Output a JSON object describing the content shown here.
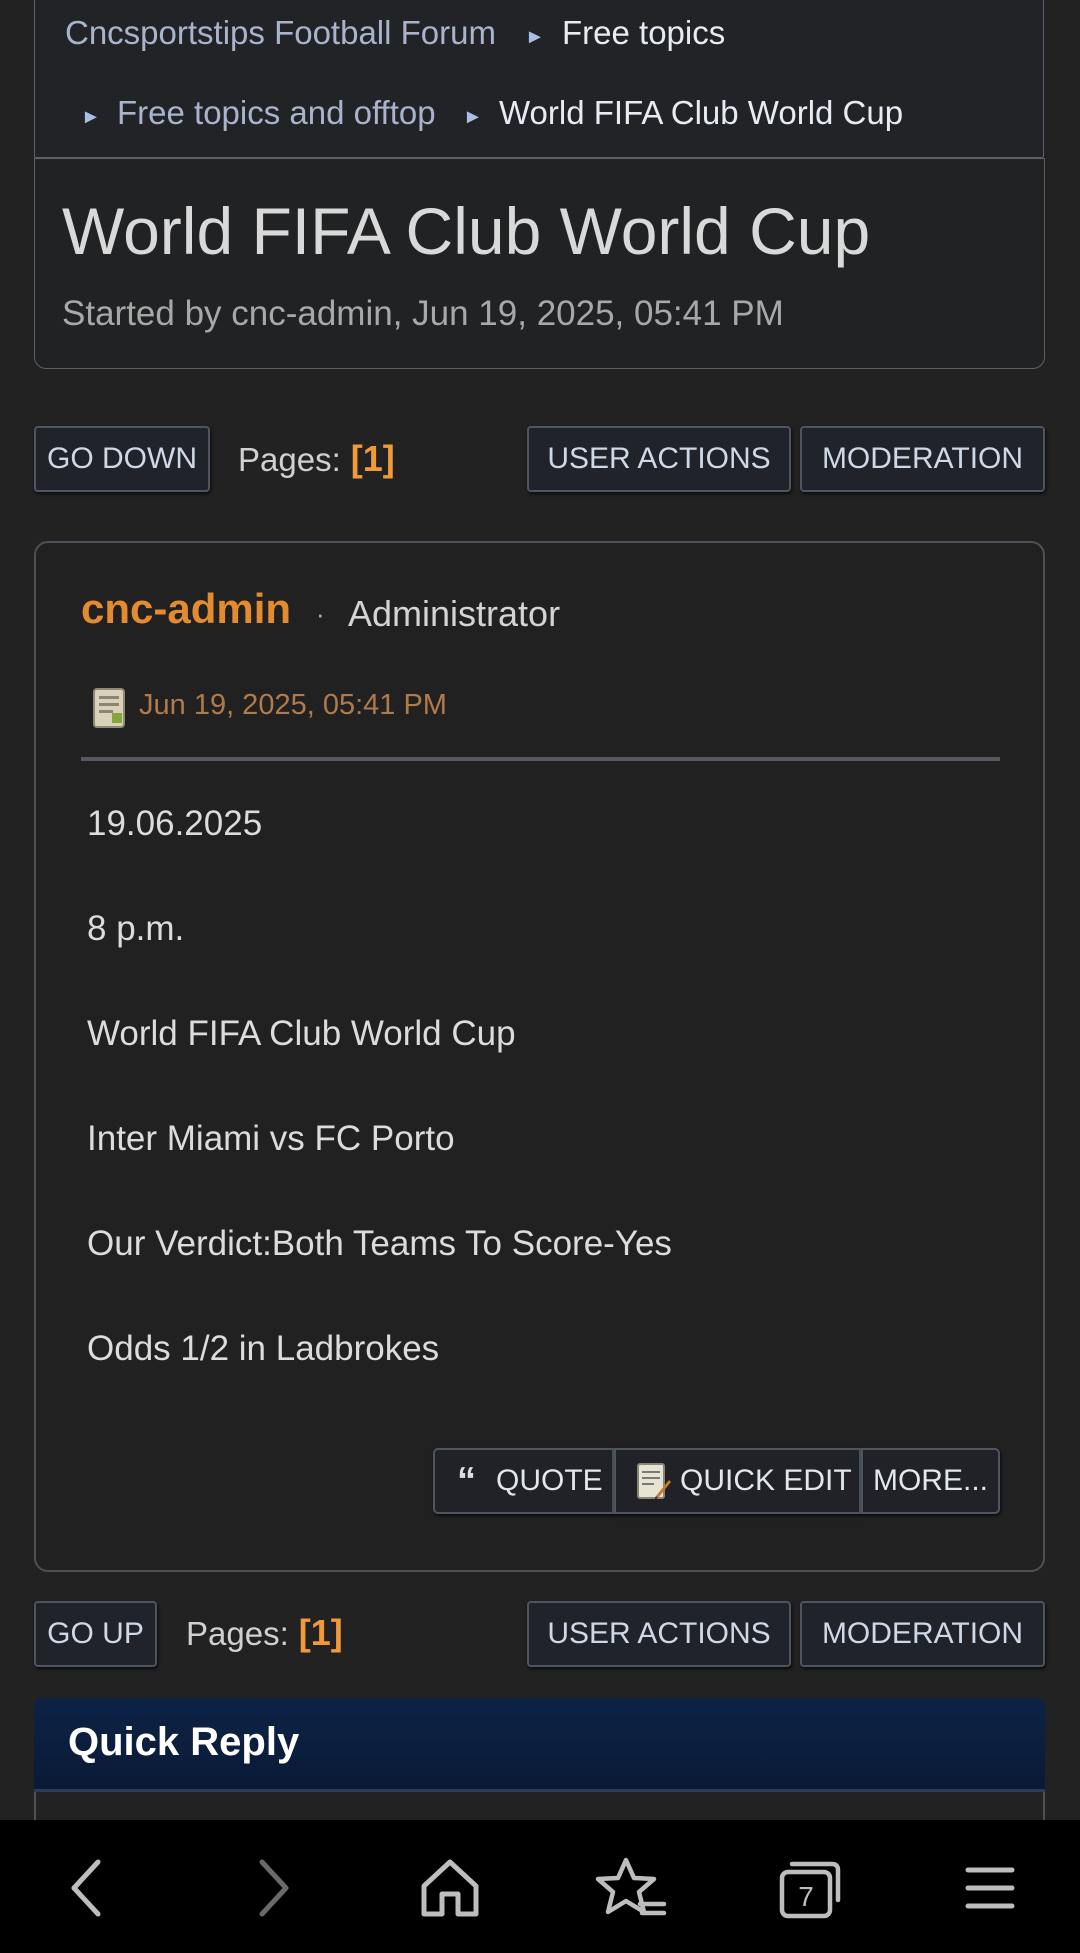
{
  "breadcrumb": {
    "forum": "Cncsportstips Football Forum",
    "section": "Free topics",
    "board": "Free topics and offtop",
    "topic": "World FIFA Club World Cup"
  },
  "topic": {
    "title": "World FIFA Club World Cup",
    "started": "Started by cnc-admin, Jun 19, 2025, 05:41 PM"
  },
  "top_controls": {
    "go_down": "GO DOWN",
    "pages_label": "Pages:",
    "page_number": "[1]",
    "user_actions": "USER ACTIONS",
    "moderation": "MODERATION"
  },
  "post": {
    "author": "cnc-admin",
    "separator": "·",
    "role": "Administrator",
    "date": "Jun 19, 2025, 05:41 PM",
    "lines": [
      "19.06.2025",
      "8 p.m.",
      "World FIFA Club World Cup",
      "Inter Miami vs FC Porto",
      "Our Verdict:Both Teams To Score-Yes",
      "Odds 1/2 in Ladbrokes"
    ],
    "quote_label": "QUOTE",
    "quick_edit_label": "QUICK EDIT",
    "more_label": "MORE..."
  },
  "bottom_controls": {
    "go_up": "GO UP",
    "pages_label": "Pages:",
    "page_number": "[1]",
    "user_actions": "USER ACTIONS",
    "moderation": "MODERATION"
  },
  "quick_reply": {
    "title": "Quick Reply"
  },
  "browser_bar": {
    "tab_count": "7",
    "icons": [
      "back-icon",
      "forward-icon",
      "home-icon",
      "bookmarks-icon",
      "tabs-icon",
      "menu-icon"
    ]
  },
  "colors": {
    "accent_orange": "#e48a2f",
    "page_number": "#f29a3a",
    "quick_reply_header": "#0d2346",
    "background": "#222222"
  }
}
